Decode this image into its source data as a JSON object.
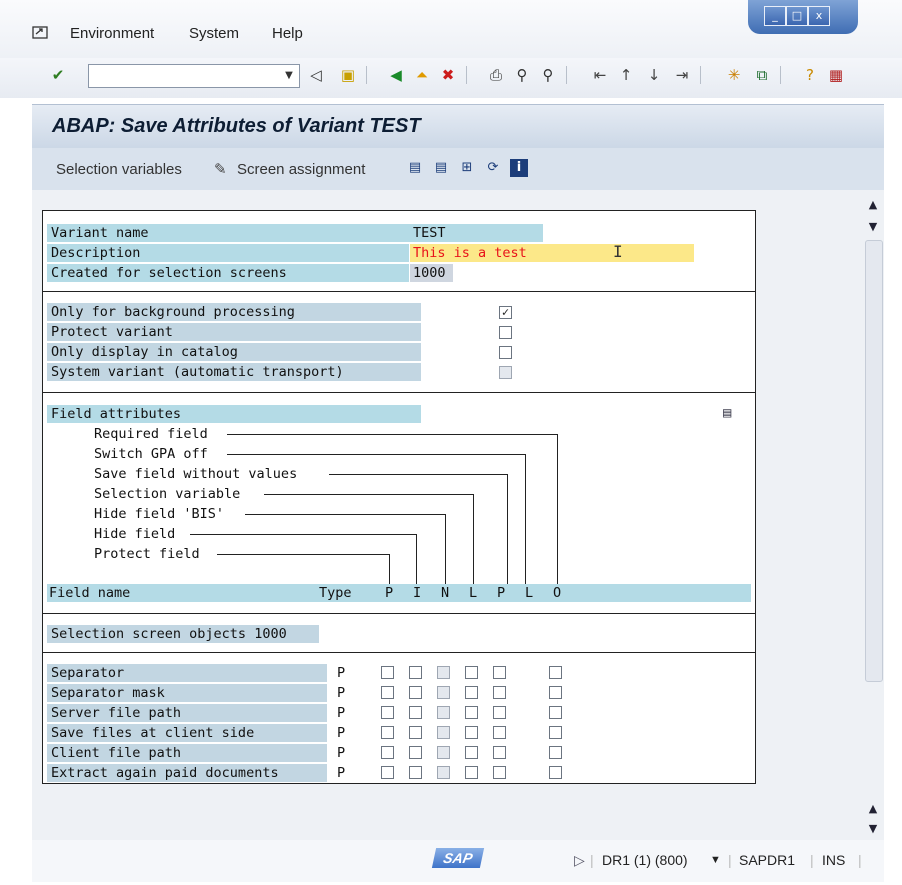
{
  "menu": {
    "items": [
      {
        "label": "Environment"
      },
      {
        "label": "System"
      },
      {
        "label": "Help"
      }
    ]
  },
  "window_controls": {
    "minimize": "_",
    "restore": "□",
    "close": "x"
  },
  "toolbar": {
    "command_value": ""
  },
  "title": "ABAP: Save Attributes of Variant TEST",
  "app_toolbar": {
    "selection_variables": "Selection variables",
    "screen_assignment": "Screen assignment"
  },
  "variant": {
    "name_label": "Variant name",
    "name_value": "TEST",
    "description_label": "Description",
    "description_value": "This is a test",
    "screens_label": "Created for selection screens",
    "screens_value": "1000"
  },
  "options": [
    {
      "label": "Only for background processing",
      "checked": true,
      "disabled": false
    },
    {
      "label": "Protect variant",
      "checked": false,
      "disabled": false
    },
    {
      "label": "Only display in catalog",
      "checked": false,
      "disabled": false
    },
    {
      "label": "System variant (automatic transport)",
      "checked": false,
      "disabled": true
    }
  ],
  "field_attributes": {
    "header": "Field attributes",
    "attrs": [
      "Required field",
      "Switch GPA off",
      "Save field without values",
      "Selection variable",
      "Hide field 'BIS'",
      "Hide field",
      "Protect field"
    ],
    "field_name_header": "Field name",
    "type_header": "Type",
    "col_letters": [
      "P",
      "I",
      "N",
      "L",
      "P",
      "L",
      "O"
    ]
  },
  "selection_objects_header": "Selection screen objects 1000",
  "rows": [
    {
      "name": "Separator",
      "type": "P"
    },
    {
      "name": "Separator mask",
      "type": "P"
    },
    {
      "name": "Server file path",
      "type": "P"
    },
    {
      "name": "Save files at client side",
      "type": "P"
    },
    {
      "name": "Client file path",
      "type": "P"
    },
    {
      "name": "Extract again paid documents",
      "type": "P"
    }
  ],
  "status": {
    "logo": "SAP",
    "system": "DR1 (1) (800)",
    "server": "SAPDR1",
    "mode": "INS"
  },
  "colors": {
    "description_text": "#e8131a",
    "description_bg": "#fce889",
    "label_bg": "#b4dbe6",
    "title_text": "#0d1d33"
  }
}
